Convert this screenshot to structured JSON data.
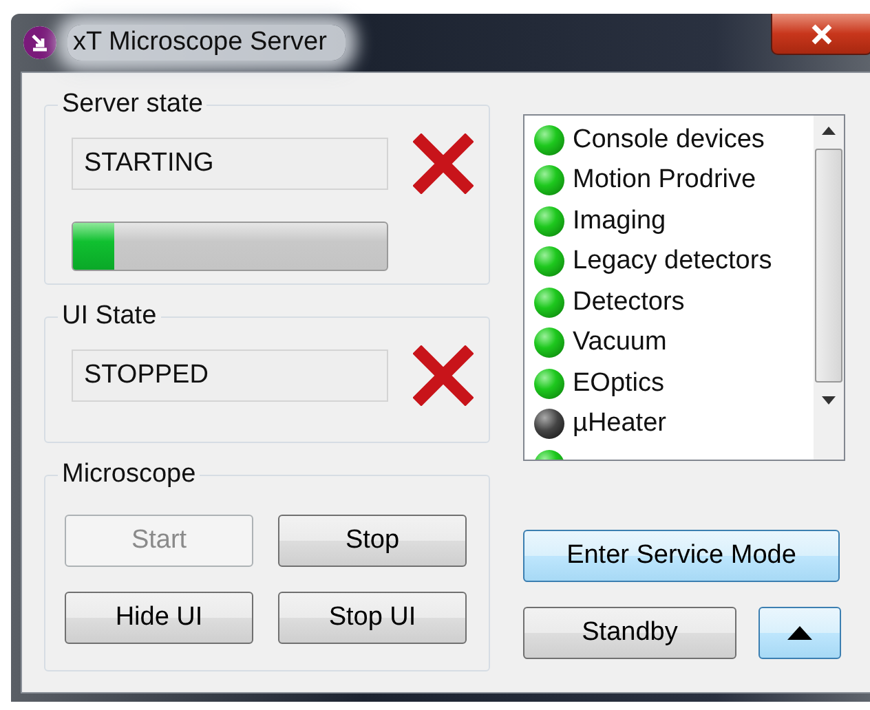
{
  "window": {
    "title": "xT Microscope Server"
  },
  "server_state": {
    "label": "Server state",
    "value": "STARTING",
    "ok": false,
    "progress": {
      "level": 0.13
    }
  },
  "ui_state": {
    "label": "UI State",
    "value": "STOPPED",
    "ok": false
  },
  "devices": [
    {
      "name": "Console devices",
      "on": true
    },
    {
      "name": "Motion Prodrive",
      "on": true
    },
    {
      "name": "Imaging",
      "on": true
    },
    {
      "name": "Legacy detectors",
      "on": true
    },
    {
      "name": "Detectors",
      "on": true
    },
    {
      "name": "Vacuum",
      "on": true
    },
    {
      "name": "EOptics",
      "on": true
    },
    {
      "name": "µHeater",
      "on": false
    },
    {
      "on": true
    }
  ],
  "microscope": {
    "label": "Microscope",
    "buttons": [
      {
        "label": "Start",
        "disabled": true
      },
      {
        "label": "Stop",
        "disabled": false
      },
      {
        "label": "Hide UI",
        "disabled": false
      },
      {
        "label": "Stop UI",
        "disabled": false
      }
    ]
  },
  "service_button": {
    "label": "Enter Service Mode",
    "highlighted": true
  },
  "standby_button": {
    "label": "Standby",
    "highlighted": false
  },
  "expand_button": {
    "highlighted": true
  }
}
